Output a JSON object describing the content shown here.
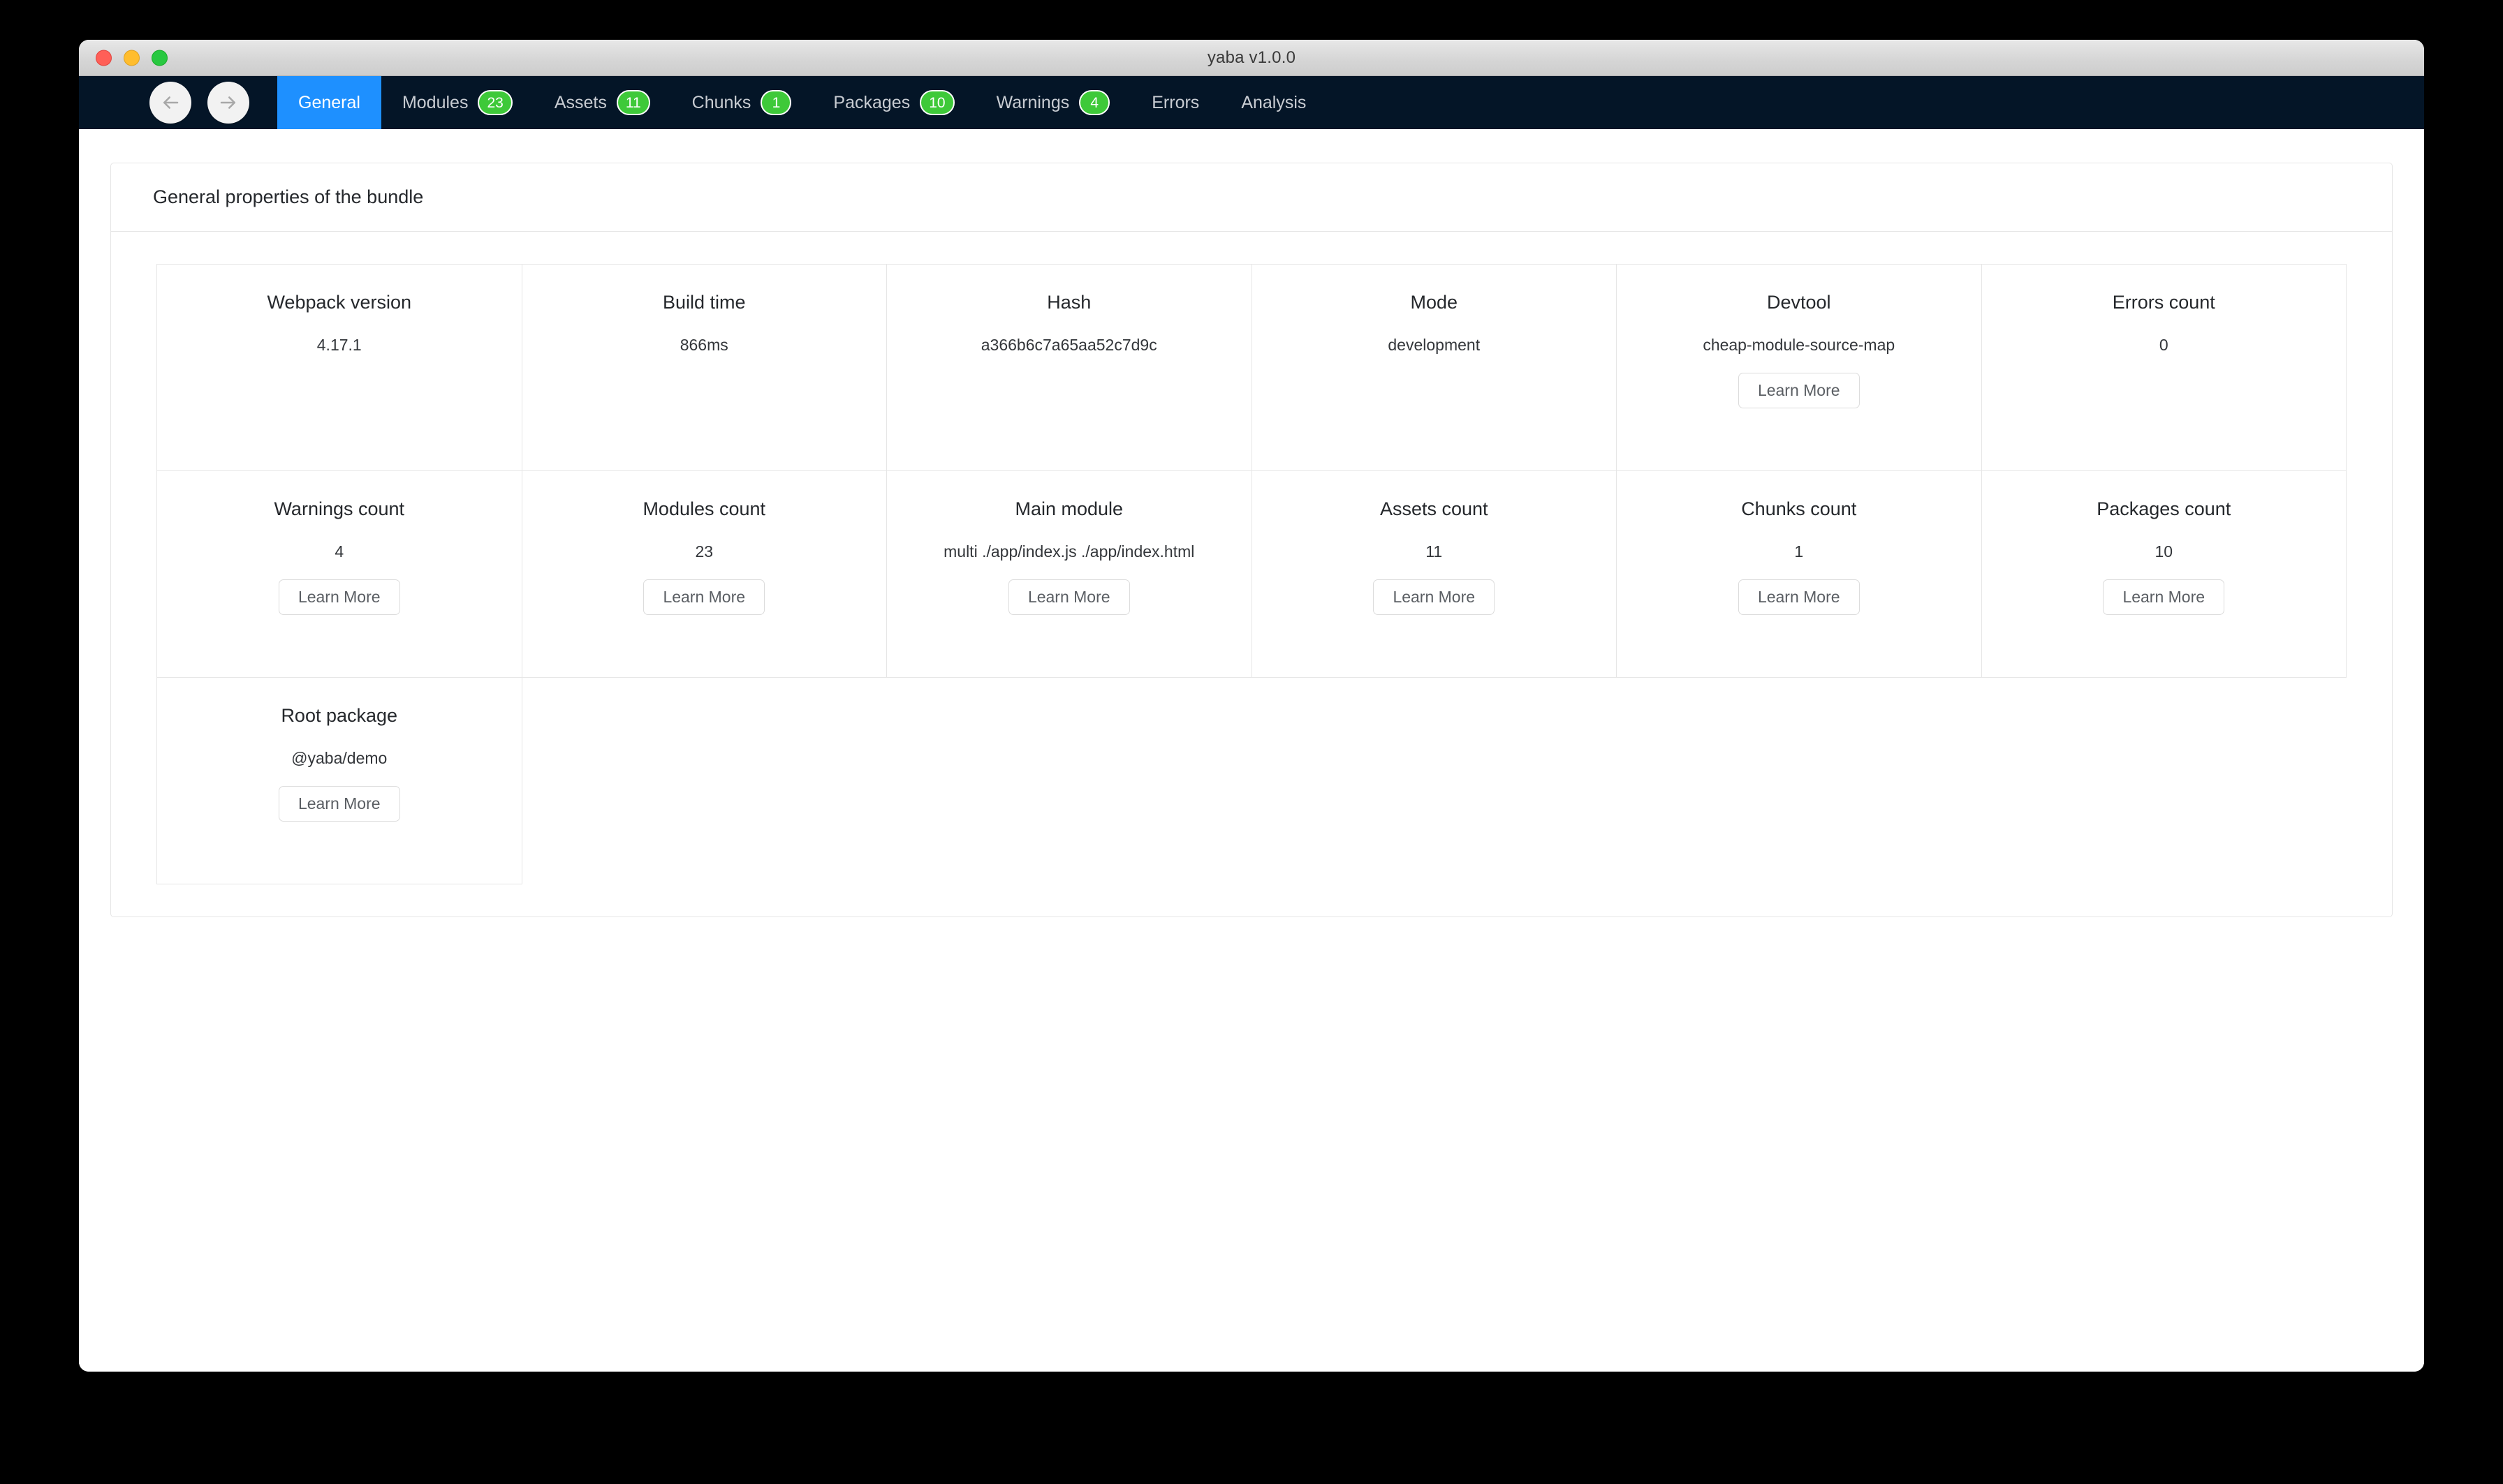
{
  "window": {
    "title": "yaba v1.0.0",
    "traffic_lights": [
      "close",
      "minimize",
      "maximize"
    ]
  },
  "navbar": {
    "background": "#041527",
    "active_color": "#1e90ff",
    "badge_color": "#3ec939",
    "back_label": "back-arrow",
    "forward_label": "forward-arrow",
    "tabs": [
      {
        "label": "General",
        "badge": null,
        "active": true
      },
      {
        "label": "Modules",
        "badge": "23",
        "active": false
      },
      {
        "label": "Assets",
        "badge": "11",
        "active": false
      },
      {
        "label": "Chunks",
        "badge": "1",
        "active": false
      },
      {
        "label": "Packages",
        "badge": "10",
        "active": false
      },
      {
        "label": "Warnings",
        "badge": "4",
        "active": false
      },
      {
        "label": "Errors",
        "badge": null,
        "active": false
      },
      {
        "label": "Analysis",
        "badge": null,
        "active": false
      }
    ]
  },
  "panel": {
    "header": "General properties of the bundle",
    "learn_more_label": "Learn More",
    "cells": [
      {
        "label": "Webpack version",
        "value": "4.17.1",
        "button": false
      },
      {
        "label": "Build time",
        "value": "866ms",
        "button": false
      },
      {
        "label": "Hash",
        "value": "a366b6c7a65aa52c7d9c",
        "button": false
      },
      {
        "label": "Mode",
        "value": "development",
        "button": false
      },
      {
        "label": "Devtool",
        "value": "cheap-module-source-map",
        "button": true
      },
      {
        "label": "Errors count",
        "value": "0",
        "button": false
      },
      {
        "label": "Warnings count",
        "value": "4",
        "button": true
      },
      {
        "label": "Modules count",
        "value": "23",
        "button": true
      },
      {
        "label": "Main module",
        "value": "multi ./app/index.js ./app/index.html",
        "button": true
      },
      {
        "label": "Assets count",
        "value": "11",
        "button": true
      },
      {
        "label": "Chunks count",
        "value": "1",
        "button": true
      },
      {
        "label": "Packages count",
        "value": "10",
        "button": true
      },
      {
        "label": "Root package",
        "value": "@yaba/demo",
        "button": true
      }
    ]
  }
}
